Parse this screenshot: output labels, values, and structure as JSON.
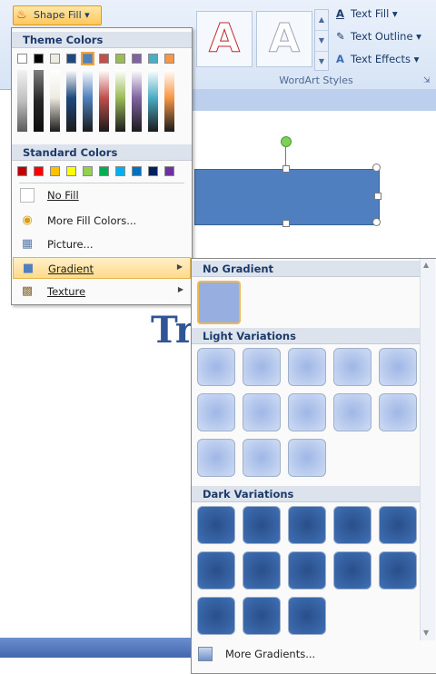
{
  "ribbon": {
    "shape_fill_label": "Shape Fill",
    "wordart_group_label": "WordArt Styles",
    "wordart_sample": "A",
    "text_fill": "Text Fill",
    "text_outline": "Text Outline",
    "text_effects": "Text Effects"
  },
  "document": {
    "big_text": "Tr"
  },
  "fill_menu": {
    "theme_colors_label": "Theme Colors",
    "standard_colors_label": "Standard Colors",
    "theme_top_row": [
      "#ffffff",
      "#000000",
      "#eeece1",
      "#1f497d",
      "#4f81bd",
      "#c0504d",
      "#9bbb59",
      "#8064a2",
      "#4bacc6",
      "#f79646"
    ],
    "standard_colors": [
      "#c00000",
      "#ff0000",
      "#ffc000",
      "#ffff00",
      "#92d050",
      "#00b050",
      "#00b0f0",
      "#0070c0",
      "#002060",
      "#7030a0"
    ],
    "items": [
      {
        "label": "No Fill"
      },
      {
        "label": "More Fill Colors..."
      },
      {
        "label": "Picture..."
      },
      {
        "label": "Gradient"
      },
      {
        "label": "Texture"
      }
    ]
  },
  "gradient_menu": {
    "no_gradient_label": "No Gradient",
    "light_variations_label": "Light Variations",
    "dark_variations_label": "Dark Variations",
    "more_gradients_label": "More Gradients..."
  },
  "colors": {
    "accent_blue": "#4f7fbe",
    "highlight": "#ffd98a"
  }
}
